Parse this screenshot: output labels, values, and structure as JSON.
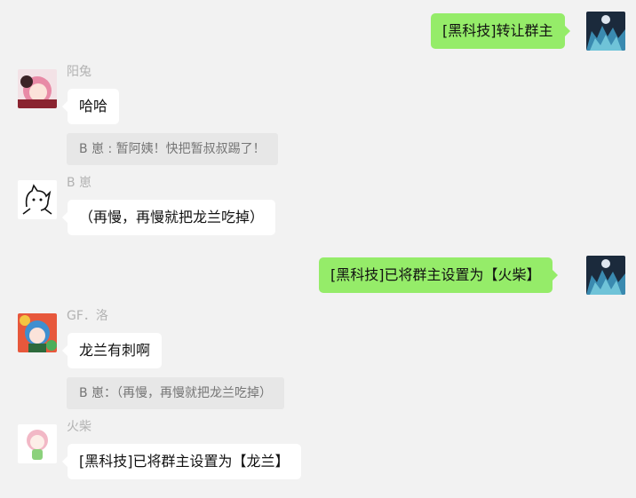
{
  "messages": [
    {
      "side": "right",
      "avatar": "night-moon-avatar",
      "text": "[黑科技]转让群主"
    },
    {
      "side": "left",
      "sender": "阳兔",
      "avatar": "pink-hair-girl-avatar",
      "text": "哈哈"
    },
    {
      "quote": "B  崽 : 暂阿姨！快把暂叔叔踢了！"
    },
    {
      "side": "left",
      "sender": "B  崽",
      "avatar": "line-drawing-cat-avatar",
      "text": "（再慢，再慢就把龙兰吃掉）"
    },
    {
      "side": "right",
      "avatar": "night-moon-avatar",
      "text": "[黑科技]已将群主设置为【火柴】"
    },
    {
      "side": "left",
      "sender": "GF．洛",
      "avatar": "blue-hair-girl-avatar",
      "text": "龙兰有刺啊"
    },
    {
      "quote": "B  崽：（再慢，再慢就把龙兰吃掉）"
    },
    {
      "side": "left",
      "sender": "火柴",
      "avatar": "chibi-girl-avatar",
      "text": "[黑科技]已将群主设置为【龙兰】"
    }
  ],
  "colors": {
    "background": "#f2f2f2",
    "incoming_bubble": "#ffffff",
    "outgoing_bubble": "#95ec69",
    "quote_bg": "#e7e7e7",
    "sender_name": "#b2b2b2"
  }
}
